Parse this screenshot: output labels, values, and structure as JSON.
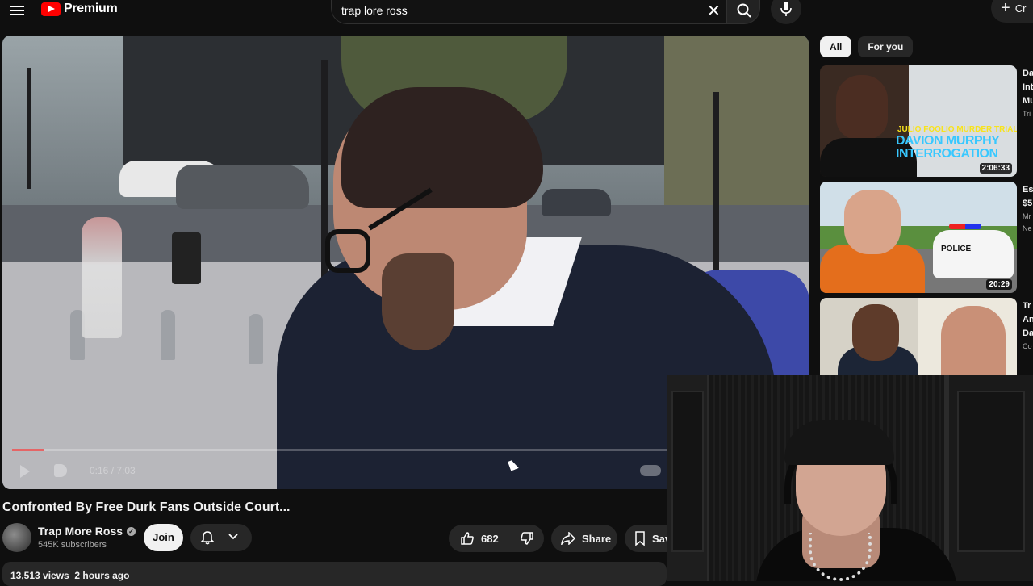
{
  "header": {
    "logo_text": "Premium",
    "search_query": "trap lore ross",
    "create_label": "Cr"
  },
  "player": {
    "time_text": "0:16 / 7:03",
    "progress": 0.04
  },
  "video": {
    "title": "Confronted By Free Durk Fans Outside Court...",
    "channel": "Trap More Ross",
    "subscribers": "545K subscribers",
    "join_label": "Join",
    "likes": "682",
    "share_label": "Share",
    "save_label": "Save",
    "views": "13,513 views",
    "age": "2 hours ago"
  },
  "sidebar": {
    "chips": [
      "All",
      "For you"
    ],
    "recommendations": [
      {
        "duration": "2:06:33",
        "title_fragment": "Da",
        "title_line2": "Int",
        "title_line3": "Mu",
        "meta": "Tri",
        "thumb_subtitle": "JULIO FOOLIO MURDER TRIAL",
        "thumb_title_1": "DAVION MURPHY",
        "thumb_title_2": "INTERROGATION"
      },
      {
        "duration": "20:29",
        "title_fragment": "Es",
        "title_line2": "$5",
        "meta": "Mr",
        "meta2": "Ne",
        "thumb_label": "POLICE"
      },
      {
        "duration": "",
        "title_fragment": "Tr",
        "title_line2": "An",
        "title_line3": "Da",
        "meta": "Co"
      }
    ]
  },
  "colors": {
    "brand": "#ff0000",
    "background": "#0f0f0f",
    "chip_active": "#f1f1f1"
  }
}
